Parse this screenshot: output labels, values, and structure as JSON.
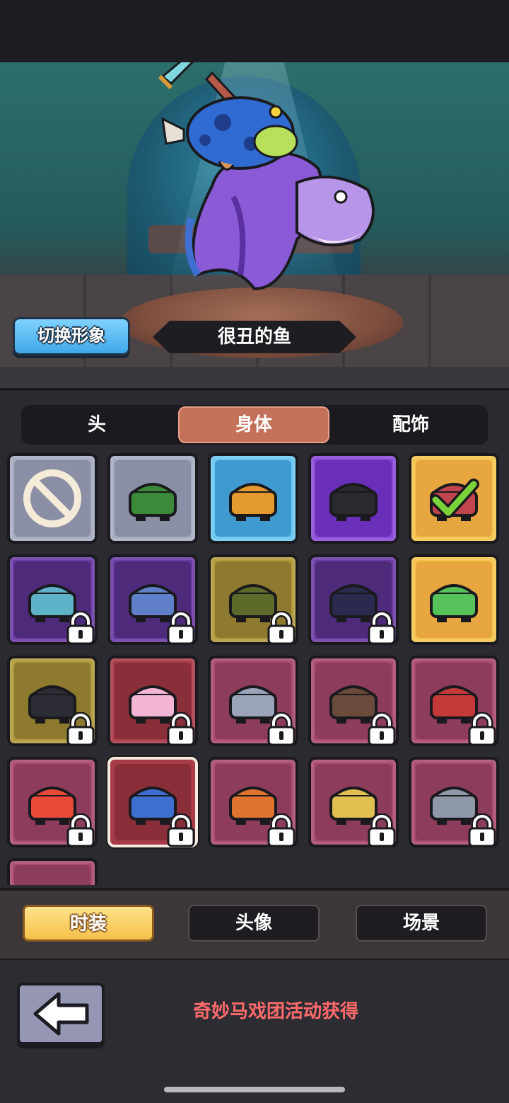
{
  "hero": {
    "switch_button_label": "切换形象",
    "character_name": "很丑的鱼"
  },
  "category_tabs": [
    {
      "label": "头",
      "active": false
    },
    {
      "label": "身体",
      "active": true
    },
    {
      "label": "配饰",
      "active": false
    }
  ],
  "items": [
    {
      "rarity": "none",
      "icon": "none-icon",
      "locked": false,
      "equipped": false
    },
    {
      "rarity": "common",
      "icon": "green-scarf-outfit-icon",
      "locked": false,
      "equipped": false
    },
    {
      "rarity": "rare",
      "icon": "orange-scarf-outfit-icon",
      "locked": false,
      "equipped": false
    },
    {
      "rarity": "epic",
      "icon": "black-scarf-outfit-icon",
      "locked": false,
      "equipped": false
    },
    {
      "rarity": "legendary",
      "icon": "red-cape-outfit-icon",
      "locked": false,
      "equipped": true
    },
    {
      "rarity": "epic",
      "icon": "fish-sword-outfit-icon",
      "locked": true,
      "equipped": false
    },
    {
      "rarity": "epic",
      "icon": "blue-cloak-outfit-icon",
      "locked": true,
      "equipped": false
    },
    {
      "rarity": "legendary",
      "icon": "olive-outfit-icon",
      "locked": true,
      "equipped": false
    },
    {
      "rarity": "epic",
      "icon": "dark-ninja-outfit-icon",
      "locked": true,
      "equipped": false
    },
    {
      "rarity": "legendary",
      "icon": "frog-costume-icon",
      "locked": false,
      "equipped": false
    },
    {
      "rarity": "legendary",
      "icon": "ninja-hood-outfit-icon",
      "locked": true,
      "equipped": false
    },
    {
      "rarity": "mythic",
      "icon": "pink-bunny-costume-icon",
      "locked": true,
      "equipped": false
    },
    {
      "rarity": "mythic",
      "icon": "knight-armor-icon",
      "locked": true,
      "equipped": false
    },
    {
      "rarity": "mythic",
      "icon": "turkey-costume-icon",
      "locked": true,
      "equipped": false
    },
    {
      "rarity": "mythic",
      "icon": "reindeer-gift-costume-icon",
      "locked": true,
      "equipped": false
    },
    {
      "rarity": "mythic",
      "icon": "lion-dance-costume-icon",
      "locked": true,
      "equipped": false
    },
    {
      "rarity": "mythic",
      "icon": "ugly-fish-costume-icon",
      "locked": true,
      "equipped": false,
      "selected": true
    },
    {
      "rarity": "mythic",
      "icon": "dragon-costume-icon",
      "locked": true,
      "equipped": false
    },
    {
      "rarity": "mythic",
      "icon": "golden-knight-costume-icon",
      "locked": true,
      "equipped": false
    },
    {
      "rarity": "mythic",
      "icon": "elephant-king-costume-icon",
      "locked": true,
      "equipped": false
    },
    {
      "rarity": "mythic",
      "icon": "partial-item-icon",
      "locked": false,
      "equipped": false
    }
  ],
  "bottom_tabs": [
    {
      "label": "时装",
      "active": true
    },
    {
      "label": "头像",
      "active": false
    },
    {
      "label": "场景",
      "active": false
    }
  ],
  "footer": {
    "hint_text": "奇妙马戏团活动获得"
  },
  "colors": {
    "rarity_common": "#a8acc2",
    "rarity_rare": "#6cc8ef",
    "rarity_epic": "#8a49d8",
    "rarity_legendary": "#f4c44f",
    "rarity_mythic": "#a94a6e",
    "hint": "#ff6b6b",
    "active_tab": "#c47159"
  }
}
